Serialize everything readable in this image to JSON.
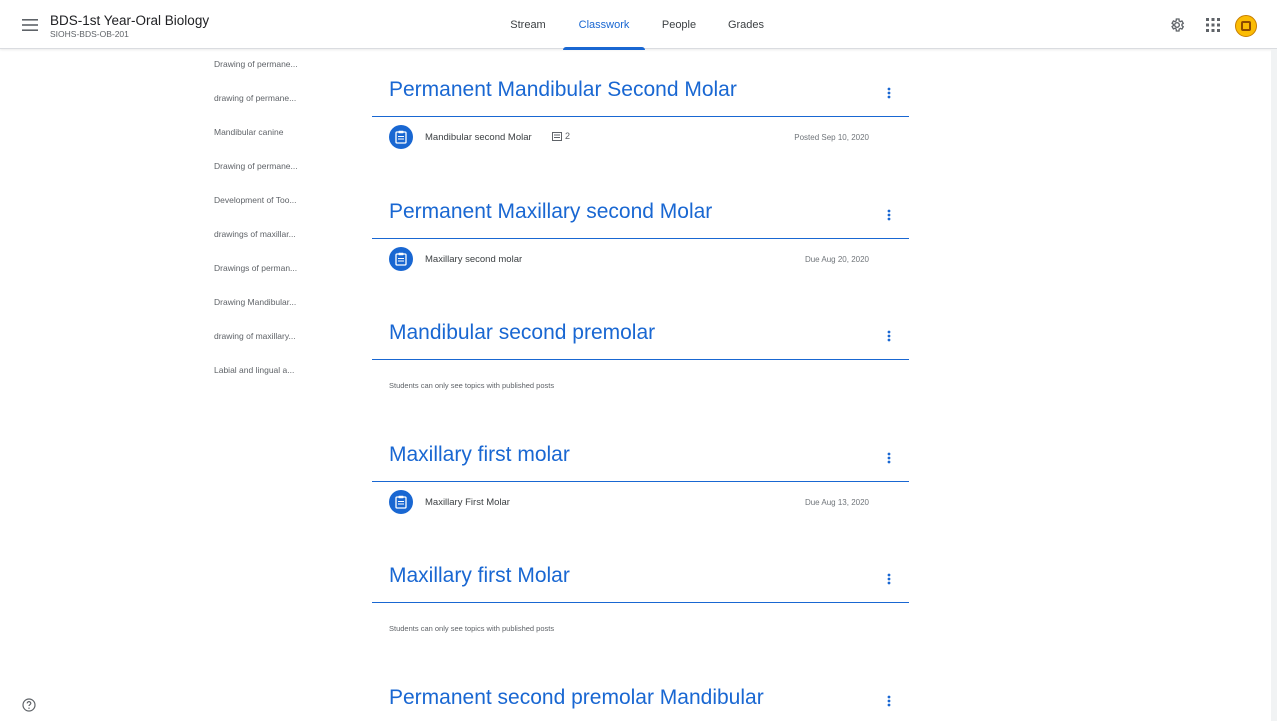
{
  "header": {
    "class_title": "BDS-1st Year-Oral Biology",
    "class_code": "SIOHS-BDS-OB-201",
    "tabs": [
      {
        "label": "Stream"
      },
      {
        "label": "Classwork"
      },
      {
        "label": "People"
      },
      {
        "label": "Grades"
      }
    ],
    "active_tab": "Classwork",
    "icons": [
      "menu-icon",
      "settings-icon",
      "apps-icon",
      "avatar"
    ]
  },
  "topic_index": [
    "Drawing of permane...",
    "drawing of permane...",
    "Mandibular canine",
    "Drawing of permane...",
    "Development of Too...",
    "drawings of maxillar...",
    "Drawings of perman...",
    "Drawing Mandibular...",
    "drawing of maxillary...",
    "Labial and lingual a..."
  ],
  "topics": [
    {
      "title": "Permanent Mandibular Second Molar",
      "item": {
        "title": "Mandibular second Molar",
        "attachments": "2",
        "date": "Posted Sep 10, 2020"
      }
    },
    {
      "title": "Permanent Maxillary second Molar",
      "item": {
        "title": "Maxillary second molar",
        "date": "Due Aug 20, 2020"
      }
    },
    {
      "title": "Mandibular second premolar",
      "note": "Students can only see topics with published posts"
    },
    {
      "title": "Maxillary first molar",
      "item": {
        "title": "Maxillary First Molar",
        "date": "Due Aug 13, 2020"
      }
    },
    {
      "title": "Maxillary first Molar",
      "note": "Students can only see topics with published posts"
    },
    {
      "title": "Permanent second premolar Mandibular"
    }
  ],
  "colors": {
    "accent": "#1967d2",
    "text": "#3c4043",
    "muted": "#5f6368",
    "divider": "#dadce0"
  }
}
